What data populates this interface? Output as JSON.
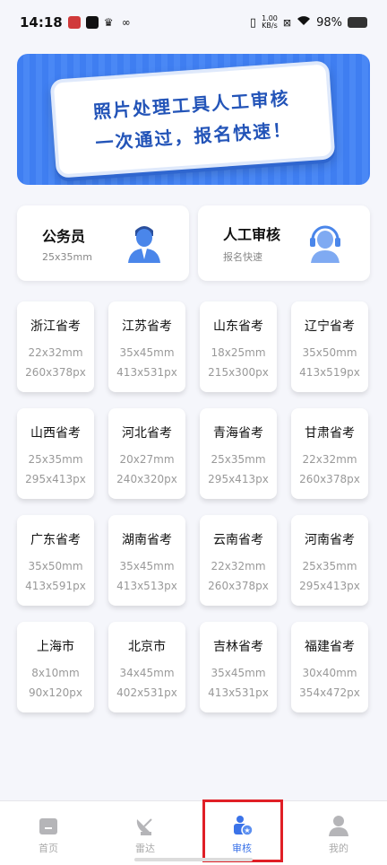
{
  "status_bar": {
    "time": "14:18",
    "net_speed_value": "1.00",
    "net_speed_unit": "KB/s",
    "battery": "98%"
  },
  "banner": {
    "line1": "照片处理工具人工审核",
    "line2": "一次通过，报名快速！"
  },
  "categories": [
    {
      "title": "公务员",
      "subtitle": "25x35mm",
      "icon": "civil-servant-icon"
    },
    {
      "title": "人工审核",
      "subtitle": "报名快速",
      "icon": "support-agent-icon"
    }
  ],
  "tiles": [
    {
      "title": "浙江省考",
      "mm": "22x32mm",
      "px": "260x378px"
    },
    {
      "title": "江苏省考",
      "mm": "35x45mm",
      "px": "413x531px"
    },
    {
      "title": "山东省考",
      "mm": "18x25mm",
      "px": "215x300px"
    },
    {
      "title": "辽宁省考",
      "mm": "35x50mm",
      "px": "413x519px"
    },
    {
      "title": "山西省考",
      "mm": "25x35mm",
      "px": "295x413px"
    },
    {
      "title": "河北省考",
      "mm": "20x27mm",
      "px": "240x320px"
    },
    {
      "title": "青海省考",
      "mm": "25x35mm",
      "px": "295x413px"
    },
    {
      "title": "甘肃省考",
      "mm": "22x32mm",
      "px": "260x378px"
    },
    {
      "title": "广东省考",
      "mm": "35x50mm",
      "px": "413x591px"
    },
    {
      "title": "湖南省考",
      "mm": "35x45mm",
      "px": "413x513px"
    },
    {
      "title": "云南省考",
      "mm": "22x32mm",
      "px": "260x378px"
    },
    {
      "title": "河南省考",
      "mm": "25x35mm",
      "px": "295x413px"
    },
    {
      "title": "上海市",
      "mm": "8x10mm",
      "px": "90x120px"
    },
    {
      "title": "北京市",
      "mm": "34x45mm",
      "px": "402x531px"
    },
    {
      "title": "吉林省考",
      "mm": "35x45mm",
      "px": "413x531px"
    },
    {
      "title": "福建省考",
      "mm": "30x40mm",
      "px": "354x472px"
    }
  ],
  "nav": [
    {
      "label": "首页",
      "icon": "home-icon",
      "active": false
    },
    {
      "label": "雷达",
      "icon": "radar-icon",
      "active": false
    },
    {
      "label": "审核",
      "icon": "review-icon",
      "active": true
    },
    {
      "label": "我的",
      "icon": "profile-icon",
      "active": false
    }
  ],
  "colors": {
    "accent": "#3b73e8",
    "banner_blue": "#3f7ef1",
    "highlight_red": "#e01f26"
  }
}
